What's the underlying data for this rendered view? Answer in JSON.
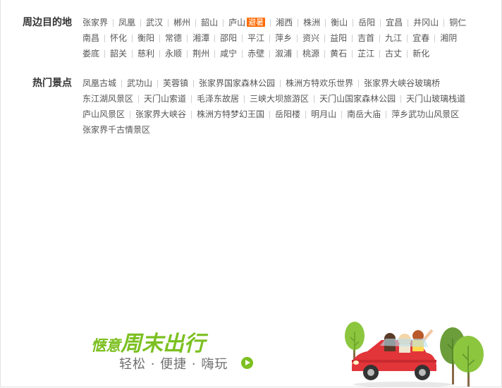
{
  "nearby": {
    "title": "周边目的地",
    "items": [
      {
        "label": "张家界"
      },
      {
        "label": "凤凰"
      },
      {
        "label": "武汉"
      },
      {
        "label": "郴州"
      },
      {
        "label": "韶山"
      },
      {
        "label": "庐山",
        "badge": "避暑"
      },
      {
        "label": "湘西"
      },
      {
        "label": "株洲"
      },
      {
        "label": "衡山"
      },
      {
        "label": "岳阳"
      },
      {
        "label": "宜昌"
      },
      {
        "label": "井冈山"
      },
      {
        "label": "铜仁"
      },
      {
        "label": "南昌"
      },
      {
        "label": "怀化"
      },
      {
        "label": "衡阳"
      },
      {
        "label": "常德"
      },
      {
        "label": "湘潭"
      },
      {
        "label": "邵阳"
      },
      {
        "label": "平江"
      },
      {
        "label": "萍乡"
      },
      {
        "label": "资兴"
      },
      {
        "label": "益阳"
      },
      {
        "label": "吉首"
      },
      {
        "label": "九江"
      },
      {
        "label": "宜春"
      },
      {
        "label": "湘阴"
      },
      {
        "label": "娄底"
      },
      {
        "label": "韶关"
      },
      {
        "label": "慈利"
      },
      {
        "label": "永顺"
      },
      {
        "label": "荆州"
      },
      {
        "label": "咸宁"
      },
      {
        "label": "赤壁"
      },
      {
        "label": "溆浦"
      },
      {
        "label": "桃源"
      },
      {
        "label": "黄石"
      },
      {
        "label": "芷江"
      },
      {
        "label": "古丈"
      },
      {
        "label": "新化"
      }
    ]
  },
  "hot": {
    "title": "热门景点",
    "items": [
      "凤凰古城",
      "武功山",
      "芙蓉镇",
      "张家界国家森林公园",
      "株洲方特欢乐世界",
      "张家界大峡谷玻璃桥",
      "东江湖风景区",
      "天门山索道",
      "毛泽东故居",
      "三峡大坝旅游区",
      "天门山国家森林公园",
      "天门山玻璃栈道",
      "庐山风景区",
      "张家界大峡谷",
      "株洲方特梦幻王国",
      "岳阳楼",
      "明月山",
      "南岳大庙",
      "萍乡武功山风景区",
      "张家界千古情景区"
    ]
  },
  "promo": {
    "slogan_small": "惬意",
    "slogan_big": "周末出行",
    "subline": "轻松 · 便捷 · 嗨玩"
  },
  "colors": {
    "accent": "#7cc021",
    "badge": "#ff6a00",
    "car": "#e2353a"
  }
}
